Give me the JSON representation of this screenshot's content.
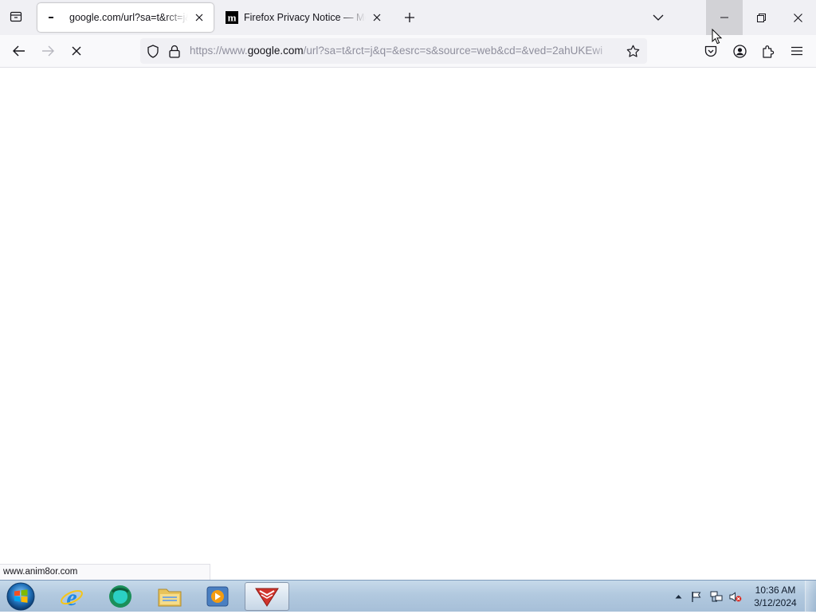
{
  "tabbar": {
    "tabs": [
      {
        "title": "google.com/url?sa=t&rct=j&q=&esrc=s&source=web",
        "favicon": "loading-dash-icon",
        "active": true
      },
      {
        "title": "Firefox Privacy Notice — Mozilla",
        "favicon": "mozilla-m-icon",
        "active": false
      }
    ],
    "icons": {
      "tab_list": "tab-list-icon",
      "new_tab": "plus-icon",
      "all_tabs": "chevron-down-icon"
    }
  },
  "window_controls": {
    "minimize": "minimize-icon",
    "restore": "restore-icon",
    "close": "close-icon"
  },
  "navbar": {
    "url_prefix": "https://www.",
    "url_domain": "google.com",
    "url_rest": "/url?sa=t&rct=j&q=&esrc=s&source=web&cd=&ved=2ahUKEwi",
    "icons": [
      "back-icon",
      "forward-icon",
      "stop-icon",
      "tracking-protection-icon",
      "lock-icon",
      "bookmark-star-icon",
      "pocket-icon",
      "account-icon",
      "extensions-icon",
      "menu-icon"
    ]
  },
  "status": {
    "link_url": "www.anim8or.com"
  },
  "taskbar": {
    "apps": [
      "start-orb",
      "internet-explorer",
      "green-orb-app",
      "file-explorer",
      "media-player",
      "anim8or"
    ],
    "clock_time": "10:36 AM",
    "clock_date": "3/12/2024"
  },
  "colors": {
    "tab_strip": "#f0f0f4",
    "toolbar": "#f9f9fb",
    "urlbar": "#f0f0f4",
    "minimize_hover": "#d2d2d6",
    "taskbar": "#b2c9df"
  }
}
